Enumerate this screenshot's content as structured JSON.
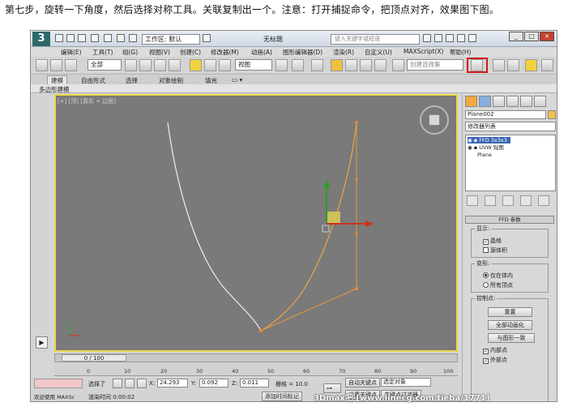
{
  "caption": "第七步，旋转一下角度，然后选择对称工具。关联复制出一个。注意：打开捕捉命令，把顶点对齐，效果图下图。",
  "titlebar": {
    "workspace": "工作区: 默认",
    "title": "无标题",
    "search_placeholder": "键入关键字或短语"
  },
  "menu": [
    "编辑(E)",
    "工具(T)",
    "组(G)",
    "视图(V)",
    "创建(C)",
    "修改器(M)",
    "动画(A)",
    "图形编辑器(D)",
    "渲染(R)",
    "自定义(U)",
    "MAXScript(X)",
    "帮助(H)"
  ],
  "toolbar": {
    "filter_value": "全部",
    "refcoord_value": "视图",
    "selection_set_placeholder": "创建选择集"
  },
  "ribbon": {
    "tabs": [
      "建模",
      "自由形式",
      "选择",
      "对象绘制",
      "填充"
    ],
    "subtab": "多边形建模"
  },
  "viewport": {
    "label": "[+] [顶] [真实 + 边面]"
  },
  "command_panel": {
    "object_name": "Plane002",
    "modifier_list": "修改器列表",
    "stack": [
      "FFD 3x3x3",
      "UVW 贴图",
      "Plane"
    ],
    "rollout_title": "FFD 参数",
    "display_group": "显示:",
    "display_options": [
      "晶格",
      "源体积"
    ],
    "deform_group": "变形:",
    "deform_options": [
      "仅在体内",
      "所有顶点"
    ],
    "control_group": "控制点:",
    "control_buttons": [
      "重置",
      "全部动画化",
      "与图形一致"
    ],
    "control_options": [
      "内部点",
      "外部点"
    ]
  },
  "timeline": {
    "slider": "0 / 100",
    "ticks": [
      "0",
      "10",
      "20",
      "30",
      "40",
      "50",
      "60",
      "70",
      "80",
      "90",
      "100"
    ]
  },
  "status": {
    "left_label": "欢迎使用 MAXSc",
    "selection_text": "选择了",
    "x_label": "X:",
    "x_value": "24.293",
    "y_label": "Y:",
    "y_value": "0.092",
    "z_label": "Z:",
    "z_value": "0.011",
    "grid_text": "栅格 = 10.0",
    "autokey_label": "自动关键点",
    "selected_object": "选定对象",
    "render_time": "渲染时间 0:00:02",
    "add_time_tag": "添加时间标记",
    "set_key_label": "设置关键点",
    "key_filters_label": "关键点过滤器"
  },
  "watermark": "3Dmax吧 [www.linecg.com/tieba/1771]"
}
